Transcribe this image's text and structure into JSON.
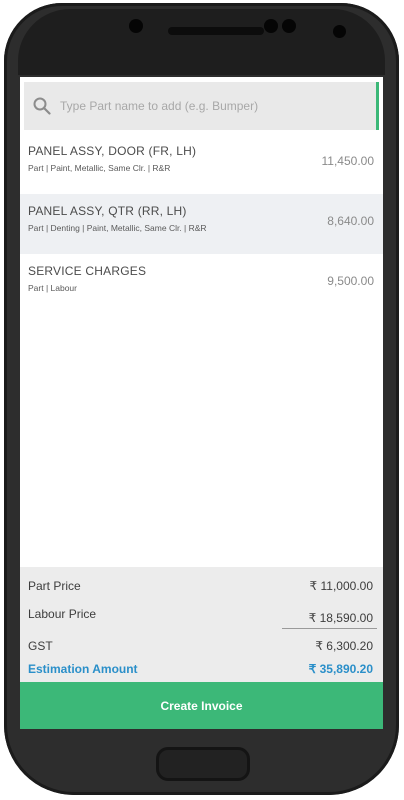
{
  "search": {
    "placeholder": "Type Part name to add (e.g. Bumper)"
  },
  "items": [
    {
      "name": "PANEL ASSY, DOOR (FR, LH)",
      "description": "Part | Paint, Metallic, Same Clr. | R&R",
      "price": "11,450.00"
    },
    {
      "name": "PANEL ASSY, QTR (RR, LH)",
      "description": "Part | Denting | Paint, Metallic, Same Clr. | R&R",
      "price": "8,640.00"
    },
    {
      "name": "SERVICE CHARGES",
      "description": "Part | Labour",
      "price": "9,500.00"
    }
  ],
  "summary": {
    "part_price_label": "Part Price",
    "part_price": "₹ 11,000.00",
    "labour_price_label": "Labour Price",
    "labour_price": "₹ 18,590.00",
    "gst_label": "GST",
    "gst": "₹ 6,300.20",
    "estimation_label": "Estimation Amount",
    "estimation": "₹ 35,890.20"
  },
  "create_invoice_label": "Create Invoice",
  "colors": {
    "accent_green": "#3cb878",
    "estimation_blue": "#2a8fc9"
  }
}
